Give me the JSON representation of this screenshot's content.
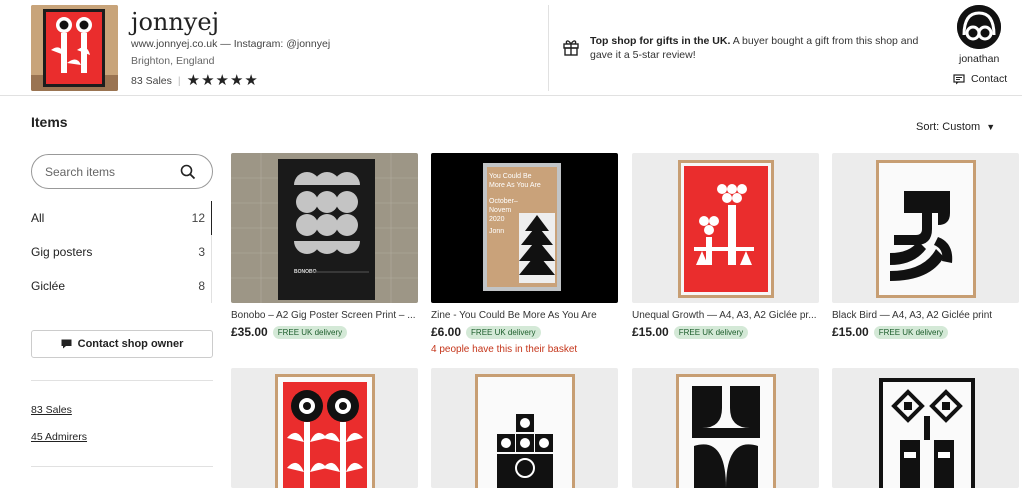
{
  "shop": {
    "name": "jonnyej",
    "links": "www.jonnyej.co.uk — Instagram: @jonnyej",
    "location": "Brighton, England",
    "sales": "83 Sales",
    "rating": 5
  },
  "top_shop": {
    "bold": "Top shop for gifts in the UK.",
    "text": " A buyer bought a gift from this shop and gave it a 5-star review!"
  },
  "owner": {
    "name": "jonathan",
    "contact_label": "Contact"
  },
  "items_heading": "Items",
  "sort": {
    "label": "Sort: Custom"
  },
  "search": {
    "placeholder": "Search items",
    "value": ""
  },
  "categories": [
    {
      "label": "All",
      "count": "12"
    },
    {
      "label": "Gig posters",
      "count": "3"
    },
    {
      "label": "Giclée",
      "count": "8"
    }
  ],
  "contact_owner_label": "Contact shop owner",
  "sidebar_links": {
    "sales": "83 Sales",
    "admirers": "45 Admirers"
  },
  "listings": [
    {
      "title": "Bonobo – A2 Gig Poster Screen Print – ...",
      "price": "£35.00",
      "badge": "FREE UK delivery",
      "note": ""
    },
    {
      "title": "Zine - You Could Be More As You Are",
      "price": "£6.00",
      "badge": "FREE UK delivery",
      "note": "4 people have this in their basket"
    },
    {
      "title": "Unequal Growth — A4, A3, A2 Giclée pr...",
      "price": "£15.00",
      "badge": "FREE UK delivery",
      "note": ""
    },
    {
      "title": "Black Bird — A4, A3, A2 Giclée print",
      "price": "£15.00",
      "badge": "FREE UK delivery",
      "note": ""
    }
  ],
  "zine_cover": {
    "line1": "You Could Be",
    "line2": "More As You Are",
    "line3": "October–",
    "line4": "Novem",
    "line5": "2020",
    "line6": "Jonn"
  },
  "poster_brand": "BONOBO",
  "colors": {
    "accent_red": "#ea2d2d",
    "badge_bg": "#d4e9d7",
    "badge_text": "#1d5e2c",
    "note_red": "#c5361b"
  }
}
